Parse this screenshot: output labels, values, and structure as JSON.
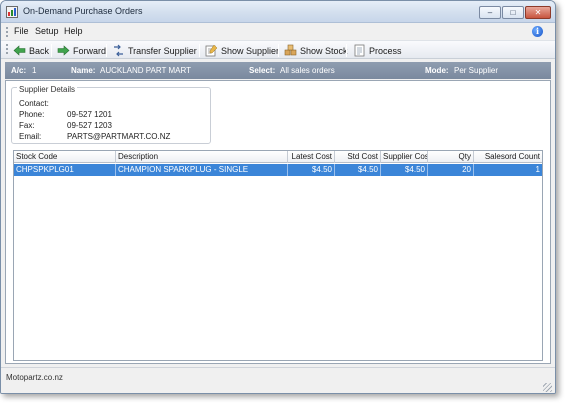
{
  "window": {
    "title": "On-Demand Purchase Orders",
    "buttons": {
      "minimize": "–",
      "maximize": "□",
      "close": "✕"
    }
  },
  "menu": {
    "file": "File",
    "setup": "Setup",
    "help": "Help",
    "info_icon_glyph": "i"
  },
  "toolbar": {
    "back": "Back",
    "forward": "Forward",
    "transfer_supplier": "Transfer Supplier",
    "show_supplier": "Show Supplier",
    "show_stock": "Show Stock",
    "process": "Process"
  },
  "account_bar": {
    "ac_label": "A/c:",
    "ac_value": "1",
    "name_label": "Name:",
    "name_value": "AUCKLAND PART MART",
    "select_label": "Select:",
    "select_value": "All sales orders",
    "mode_label": "Mode:",
    "mode_value": "Per Supplier"
  },
  "supplier_details": {
    "legend": "Supplier Details",
    "contact_label": "Contact:",
    "contact_value": "",
    "phone_label": "Phone:",
    "phone_value": "09-527 1201",
    "fax_label": "Fax:",
    "fax_value": "09-527 1203",
    "email_label": "Email:",
    "email_value": "PARTS@PARTMART.CO.NZ"
  },
  "grid": {
    "columns": [
      "Stock Code",
      "Description",
      "Latest Cost",
      "Std Cost",
      "Supplier Cost",
      "Qty",
      "Salesord Count"
    ],
    "rows": [
      [
        "CHPSPKPLG01",
        "CHAMPION SPARKPLUG - SINGLE",
        "$4.50",
        "$4.50",
        "$4.50",
        "20",
        "1"
      ]
    ]
  },
  "status": {
    "text": "Motopartz.co.nz"
  },
  "colors": {
    "selection": "#3b85d8",
    "account_bar": "#7f8ea3",
    "title_gradient": "#d3dfee"
  },
  "icons": [
    "app-icon",
    "back-arrow-icon",
    "forward-arrow-icon",
    "transfer-icon",
    "show-supplier-icon",
    "show-stock-icon",
    "process-icon",
    "info-icon"
  ]
}
